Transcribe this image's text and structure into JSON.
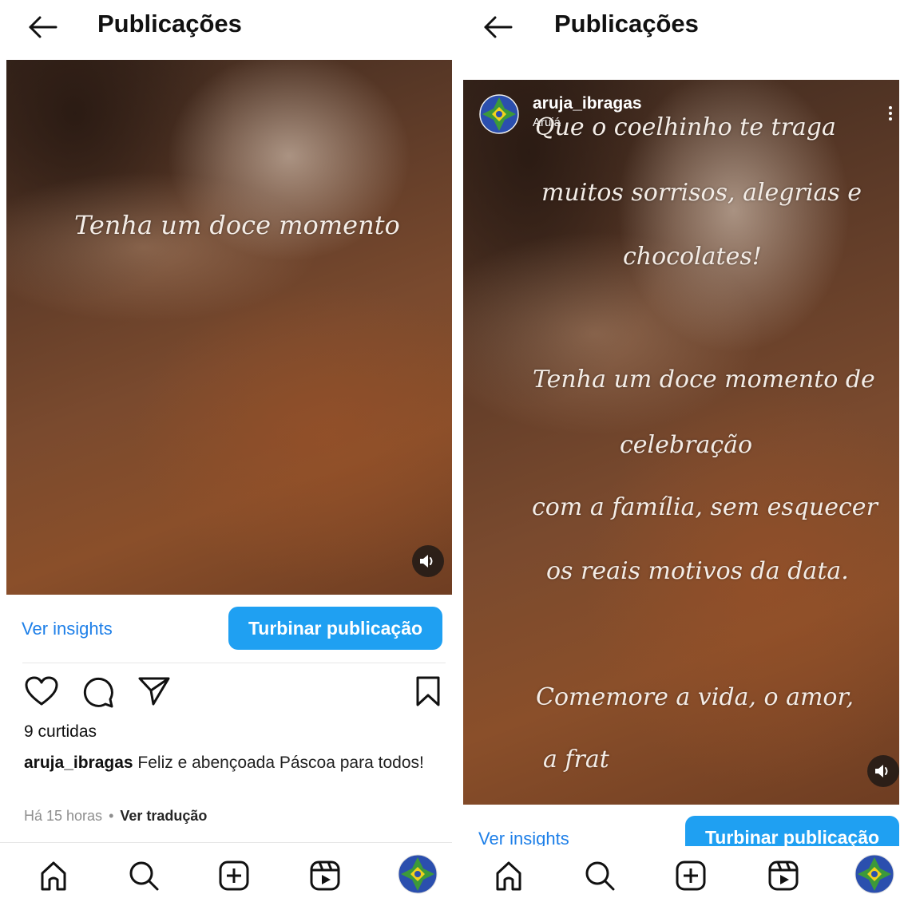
{
  "screens": [
    {
      "header": {
        "title": "Publicações"
      },
      "post": {
        "media_caption": "Tenha um doce momento",
        "insights_label": "Ver insights",
        "boost_label": "Turbinar publicação",
        "likes": "9 curtidas",
        "caption_user": "aruja_ibragas",
        "caption_text": "Feliz e abençoada  Páscoa para todos!",
        "time": "Há 15 horas",
        "separator": "•",
        "translate_label": "Ver tradução"
      }
    },
    {
      "header": {
        "title": "Publicações"
      },
      "post": {
        "account_name": "aruja_ibragas",
        "account_location": "Arujá",
        "media_lines": [
          "Que o coelhinho te traga",
          "muitos sorrisos, alegrias  e",
          "chocolates!",
          "Tenha um doce momento de",
          "celebração",
          "com a família, sem esquecer",
          "os reais motivos da data.",
          "Comemore  a vida, o amor,",
          "a frat"
        ],
        "insights_label": "Ver insights",
        "boost_label": "Turbinar publicação"
      }
    }
  ],
  "icons": {
    "back": "back-arrow-icon",
    "sound": "speaker-icon",
    "like": "heart-icon",
    "comment": "comment-bubble-icon",
    "share": "paper-plane-icon",
    "save": "bookmark-icon",
    "more": "more-options-icon",
    "nav": [
      "home-icon",
      "search-icon",
      "add-post-icon",
      "reels-icon",
      "profile-avatar-icon"
    ]
  },
  "colors": {
    "accent_blue": "#1fa0f2",
    "link_blue": "#1d7fe8",
    "media_brown": "#7a4a2e",
    "muted_text": "#8e8e8e"
  }
}
